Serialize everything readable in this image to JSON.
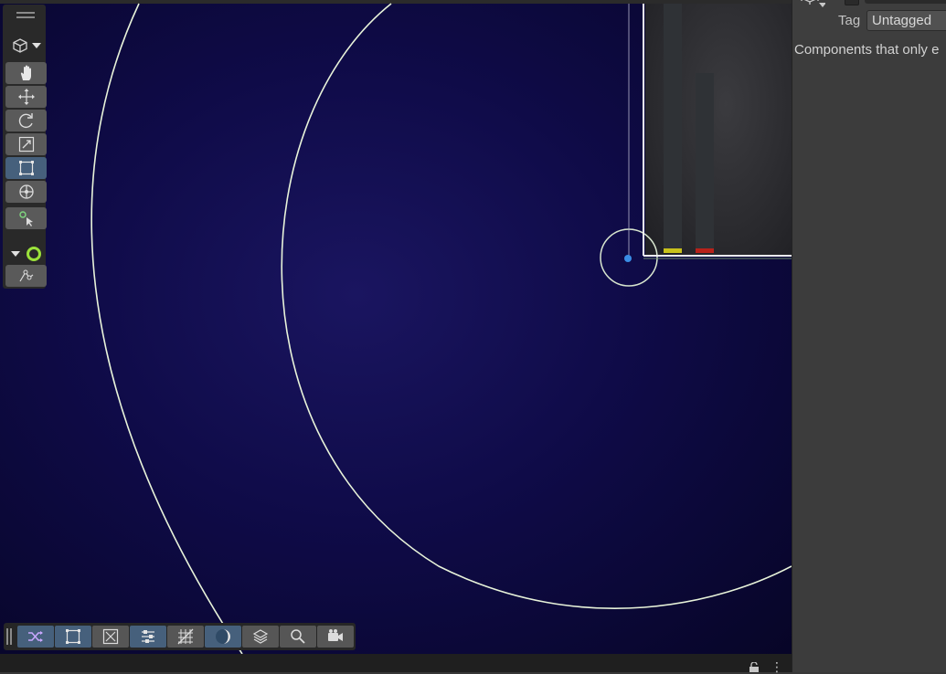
{
  "inspector": {
    "tag_label": "Tag",
    "tag_value": "Untagged",
    "components_message": "Components that only e"
  },
  "tools": {
    "items": [
      {
        "name": "hand-tool",
        "icon": "hand-icon",
        "active": false
      },
      {
        "name": "move-tool",
        "icon": "move-arrows-icon",
        "active": false
      },
      {
        "name": "rotate-tool",
        "icon": "rotate-icon",
        "active": false
      },
      {
        "name": "scale-tool",
        "icon": "scale-icon",
        "active": false
      },
      {
        "name": "rect-tool",
        "icon": "rect-transform-icon",
        "active": true
      },
      {
        "name": "transform-tool",
        "icon": "transform-icon",
        "active": false
      },
      {
        "name": "custom-tool",
        "icon": "custom-tool-icon",
        "active": false
      }
    ]
  },
  "overlay_toolbar": {
    "items": [
      {
        "name": "shuffle-view",
        "icon": "shuffle-icon",
        "active": true
      },
      {
        "name": "rect-select",
        "icon": "rect-select-icon",
        "active": true
      },
      {
        "name": "gizmo-toggle",
        "icon": "gizmo-icon",
        "active": false
      },
      {
        "name": "settings-toggle",
        "icon": "sliders-icon",
        "active": true
      },
      {
        "name": "grid-toggle",
        "icon": "grid-icon",
        "active": false
      },
      {
        "name": "shading-toggle",
        "icon": "moon-icon",
        "active": true
      },
      {
        "name": "layers-toggle",
        "icon": "layers-icon",
        "active": false
      },
      {
        "name": "search-toggle",
        "icon": "search-icon",
        "active": false
      },
      {
        "name": "camera-toggle",
        "icon": "camera-icon",
        "active": false
      }
    ]
  },
  "colors": {
    "scene_bg": "#0f0b48",
    "active_tool": "#46607c",
    "gizmo_ring": "#e8f3da",
    "gizmo_accent": "#9be23b",
    "pillar_cap_yellow": "#c8c11c",
    "pillar_cap_red": "#b8221a"
  }
}
